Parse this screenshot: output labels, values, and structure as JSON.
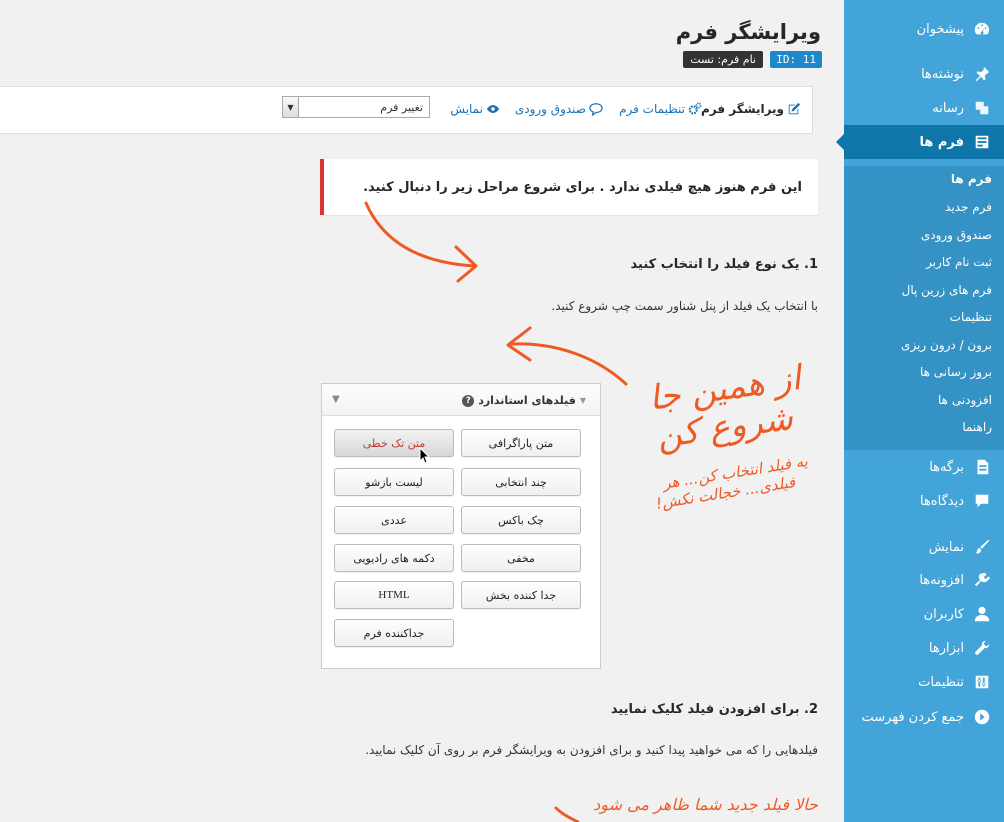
{
  "header": {
    "title": "ویرایشگر فرم",
    "id_badge": "ID: 11",
    "name_badge": "نام فرم: تست"
  },
  "toolbar": {
    "items": [
      {
        "label": "ویرایشگر فرم",
        "icon": "edit-icon"
      },
      {
        "label": "تنظیمات فرم",
        "icon": "gears-icon"
      },
      {
        "label": "صندوق ورودی",
        "icon": "speech-bubble-icon"
      },
      {
        "label": "نمایش",
        "icon": "eye-icon"
      }
    ],
    "select_value": "تغییر فرم"
  },
  "notice": "این فرم هنوز هیچ فیلدی ندارد . برای شروع مراحل زیر را دنبال کنید.",
  "steps": [
    {
      "title": "1. یک نوع فیلد را انتخاب کنید",
      "desc": "با انتخاب یک فیلد از پنل شناور سمت چپ شروع کنید."
    },
    {
      "title": "2. برای افزودن فیلد کلیک نمایید",
      "desc": "فیلدهایی را که می خواهید پیدا کنید و برای افزودن به ویرایشگر فرم بر روی آن کلیک نمایید."
    }
  ],
  "fields_panel": {
    "title": "فیلدهای استاندارد",
    "buttons": [
      "متن پاراگرافی",
      "متن تک خطی",
      "چند انتخابی",
      "لیست بازشو",
      "چک باکس",
      "عددی",
      "مخفی",
      "دکمه های رادیویی",
      "جدا کننده بخش",
      "HTML",
      "جداکننده فرم"
    ]
  },
  "annotations": {
    "start_here_1": "از همین جا",
    "start_here_2": "شروع کن",
    "pick_1": "یه فیلد انتخاب کن... هر",
    "pick_2": "فیلدی... خجالت نکش!",
    "new_field": "حالا فیلد جدید شما ظاهر می شود"
  },
  "sidebar": {
    "items": [
      {
        "label": "پیشخوان",
        "icon": "dashboard-icon"
      },
      {
        "label": "نوشته‌ها",
        "icon": "pin-icon"
      },
      {
        "label": "رسانه",
        "icon": "media-icon"
      },
      {
        "label": "فرم ها",
        "icon": "form-icon"
      },
      {
        "label": "برگه‌ها",
        "icon": "page-icon"
      },
      {
        "label": "دیدگاه‌ها",
        "icon": "comment-icon"
      },
      {
        "label": "نمایش",
        "icon": "brush-icon"
      },
      {
        "label": "افزونه‌ها",
        "icon": "plugin-icon"
      },
      {
        "label": "کاربران",
        "icon": "user-icon"
      },
      {
        "label": "ابزارها",
        "icon": "wrench-icon"
      },
      {
        "label": "تنظیمات",
        "icon": "settings-icon"
      },
      {
        "label": "جمع کردن فهرست",
        "icon": "collapse-icon"
      }
    ],
    "submenu": [
      "فرم ها",
      "فرم جدید",
      "صندوق ورودی",
      "ثبت نام کاربر",
      "فرم های زرین پال",
      "تنظیمات",
      "برون / درون ریزی",
      "بروز رسانی ها",
      "افزودنی ها",
      "راهنما"
    ]
  },
  "colors": {
    "sidebar": "#42a4d8",
    "sidebar_active": "#0e76a8",
    "accent": "#ef5a24",
    "notice_border": "#dc3232"
  }
}
